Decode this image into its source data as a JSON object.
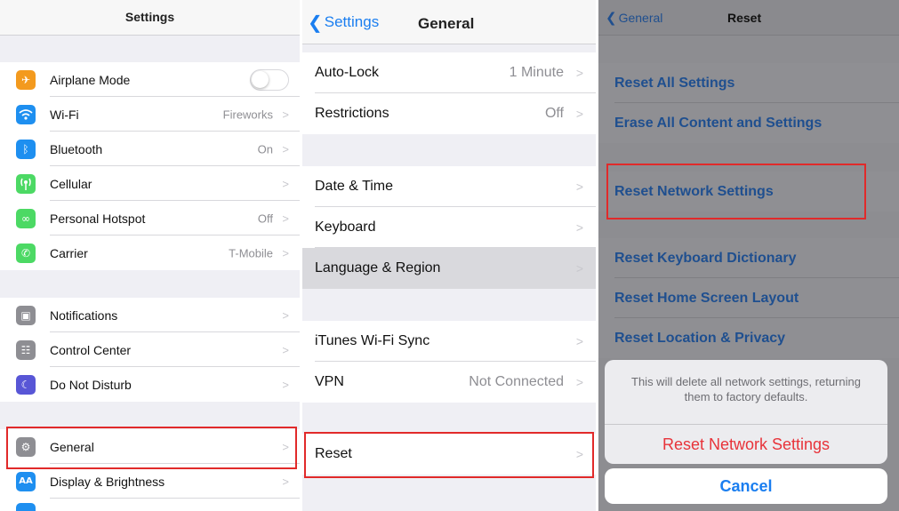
{
  "colors": {
    "accent": "#1a7ef0",
    "destructive": "#e8333a",
    "highlight": "#e12a2a"
  },
  "settings": {
    "title": "Settings",
    "groups": [
      [
        {
          "label": "Airplane Mode",
          "value": "",
          "icon": "airplane-icon",
          "toggle": true,
          "toggle_on": false,
          "color": "#f39a1e",
          "glyph": "✈"
        },
        {
          "label": "Wi-Fi",
          "value": "Fireworks",
          "icon": "wifi-icon",
          "color": "#1e8ff0",
          "glyph": "◠"
        },
        {
          "label": "Bluetooth",
          "value": "On",
          "icon": "bluetooth-icon",
          "color": "#1e8ff0",
          "glyph": "ᛒ"
        },
        {
          "label": "Cellular",
          "value": "",
          "icon": "cellular-icon",
          "color": "#4cd964",
          "glyph": "⌾"
        },
        {
          "label": "Personal Hotspot",
          "value": "Off",
          "icon": "hotspot-icon",
          "color": "#4cd964",
          "glyph": "∞"
        },
        {
          "label": "Carrier",
          "value": "T-Mobile",
          "icon": "phone-icon",
          "color": "#4cd964",
          "glyph": "✆"
        }
      ],
      [
        {
          "label": "Notifications",
          "value": "",
          "icon": "notifications-icon",
          "color": "#8e8e93",
          "glyph": "▣"
        },
        {
          "label": "Control Center",
          "value": "",
          "icon": "control-center-icon",
          "color": "#8e8e93",
          "glyph": "☷"
        },
        {
          "label": "Do Not Disturb",
          "value": "",
          "icon": "moon-icon",
          "color": "#5856d6",
          "glyph": "☾"
        }
      ],
      [
        {
          "label": "General",
          "value": "",
          "icon": "gear-icon",
          "color": "#8e8e93",
          "glyph": "⚙"
        },
        {
          "label": "Display & Brightness",
          "value": "",
          "icon": "display-icon",
          "color": "#1e8ff0",
          "glyph": "AA"
        },
        {
          "label": "",
          "value": "",
          "icon": "wallpaper-icon",
          "color": "#1e8ff0",
          "glyph": ""
        }
      ]
    ]
  },
  "general": {
    "back_label": "Settings",
    "title": "General",
    "groups": [
      [
        {
          "label": "Auto-Lock",
          "value": "1 Minute"
        },
        {
          "label": "Restrictions",
          "value": "Off"
        }
      ],
      [
        {
          "label": "Date & Time",
          "value": ""
        },
        {
          "label": "Keyboard",
          "value": ""
        },
        {
          "label": "Language & Region",
          "value": "",
          "pressed": true
        }
      ],
      [
        {
          "label": "iTunes Wi-Fi Sync",
          "value": ""
        },
        {
          "label": "VPN",
          "value": "Not Connected"
        }
      ],
      [
        {
          "label": "Reset",
          "value": ""
        }
      ]
    ]
  },
  "reset": {
    "back_label": "General",
    "title": "Reset",
    "items": [
      "Reset All Settings",
      "Erase All Content and Settings",
      "Reset Network Settings",
      "Reset Keyboard Dictionary",
      "Reset Home Screen Layout",
      "Reset Location & Privacy"
    ],
    "sheet": {
      "message": "This will delete all network settings, returning them to factory defaults.",
      "confirm_label": "Reset Network Settings",
      "cancel_label": "Cancel"
    }
  }
}
